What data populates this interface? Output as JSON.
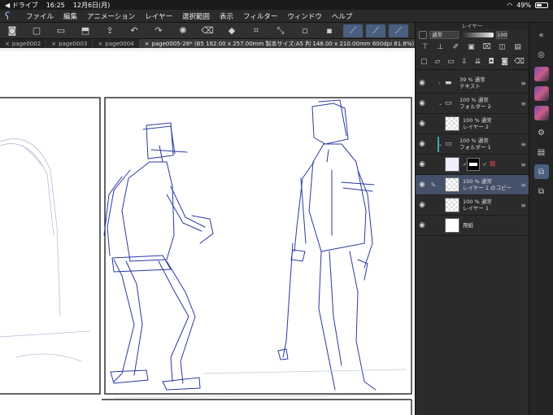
{
  "status": {
    "app_back": "◀ ドライブ",
    "time": "16:25",
    "date": "12月6日(月)",
    "battery": "49%",
    "battery_level": 0.49
  },
  "menu": [
    "ファイル",
    "編集",
    "アニメーション",
    "レイヤー",
    "選択範囲",
    "表示",
    "フィルター",
    "ウィンドウ",
    "ヘルプ"
  ],
  "tabs": [
    {
      "label": "page0002"
    },
    {
      "label": "page0003"
    },
    {
      "label": "page0004"
    },
    {
      "label": "page0005-28* (B5 182.00 x 257.00mm 製本サイズ:A5 判 148.00 x 210.00mm 600dpi 81.8%)"
    }
  ],
  "layer_panel": {
    "title": "レイヤー",
    "blend_mode": "通常",
    "opacity": "100",
    "layers": [
      {
        "line1": "39 % 通常",
        "line2": "テキスト",
        "kind": "folder"
      },
      {
        "line1": "100 % 通常",
        "line2": "フォルダー 2",
        "kind": "folder-open"
      },
      {
        "line1": "100 % 通常",
        "line2": "レイヤー 2",
        "kind": "raster"
      },
      {
        "line1": "100 % 通常",
        "line2": "フォルダー 1",
        "kind": "folder-open"
      },
      {
        "line1": "",
        "line2": "",
        "kind": "masked"
      },
      {
        "line1": "100 % 通常",
        "line2": "レイヤー 1 のコピー",
        "kind": "raster",
        "selected": true
      },
      {
        "line1": "100 % 通常",
        "line2": "レイヤー 1",
        "kind": "raster"
      },
      {
        "line1": "",
        "line2": "用紙",
        "kind": "paper"
      }
    ]
  }
}
